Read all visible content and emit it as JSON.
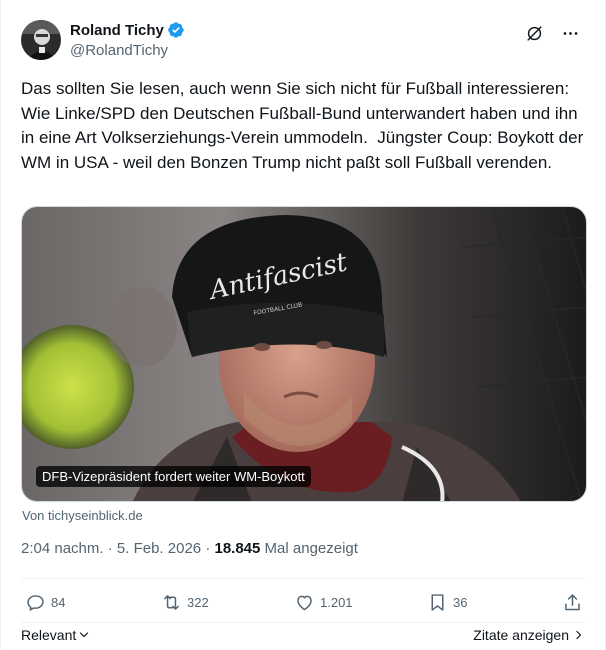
{
  "author": {
    "display_name": "Roland Tichy",
    "handle": "@RolandTichy",
    "verified": true
  },
  "tweet_text": "Das sollten Sie lesen, auch wenn Sie sich nicht für Fußball interessieren: Wie Linke/SPD den Deutschen Fußball-Bund unterwandert haben und ihn in eine Art Volkserziehungs-Verein ummodeln.  Jüngster Coup: Boykott der WM in USA - weil den Bonzen Trump nicht paßt soll Fußball verenden.",
  "card": {
    "caption": "DFB-Vizepräsident fordert weiter WM-Boykott",
    "beanie_text": "Antifascist",
    "beanie_subtext": "FOOTBALL CLUB",
    "source": "Von tichyseinblick.de"
  },
  "meta": {
    "time": "2:04 nachm.",
    "separator": "·",
    "date": "5. Feb. 2026",
    "separator2": "·",
    "views": "18.845",
    "views_label": "Mal angezeigt"
  },
  "stats": {
    "replies": "84",
    "reposts": "322",
    "likes": "1.201",
    "bookmarks": "36"
  },
  "footer": {
    "relevant_label": "Relevant",
    "quotes_label": "Zitate anzeigen"
  },
  "colors": {
    "verified_blue": "#1d9bf0",
    "secondary_text": "#536471"
  },
  "icons": {
    "menu": "more-icon",
    "grok": "grok-icon",
    "reply": "reply-icon",
    "repost": "repost-icon",
    "like": "like-icon",
    "bookmark": "bookmark-icon",
    "share": "share-icon"
  }
}
